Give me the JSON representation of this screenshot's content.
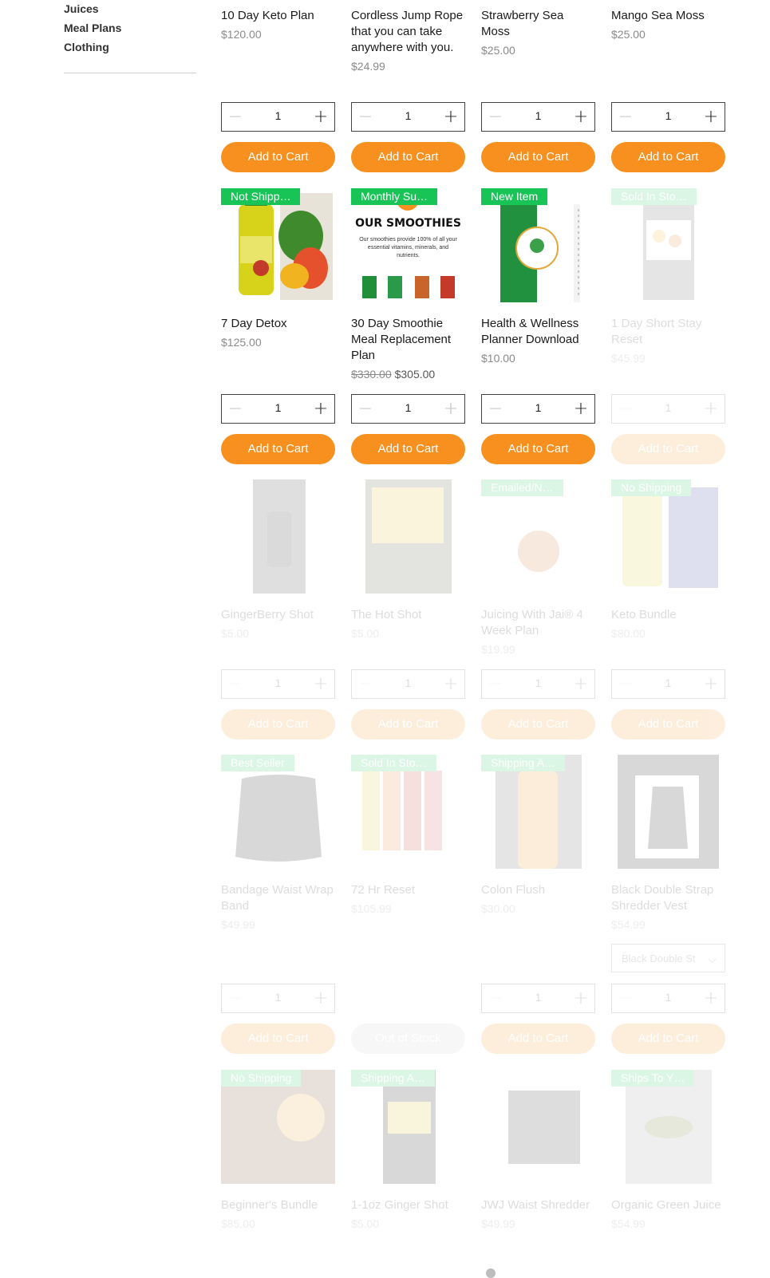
{
  "sidebar": {
    "categories": [
      "Juices",
      "Meal Plans",
      "Clothing"
    ]
  },
  "qty_default": "1",
  "icons": {
    "minus": "minus-icon",
    "plus": "plus-icon",
    "chevron": "chevron-down-icon"
  },
  "colors": {
    "accent": "#f7901e",
    "ribbon": "#17c455"
  },
  "row1": [
    {
      "name": "10 Day Keto Plan",
      "price": "$120.00",
      "button": "Add to Cart"
    },
    {
      "name": "Cordless Jump Rope that you can take anywhere with you.",
      "price": "$24.99",
      "button": "Add to Cart"
    },
    {
      "name": "Strawberry Sea Moss",
      "price": "$25.00",
      "button": "Add to Cart"
    },
    {
      "name": "Mango Sea Moss",
      "price": "$25.00",
      "button": "Add to Cart"
    }
  ],
  "row2": [
    {
      "ribbon": "Not Shipp…",
      "name": "7 Day Detox",
      "price": "$125.00",
      "button": "Add to Cart"
    },
    {
      "ribbon": "Monthly Su…",
      "name": "30 Day Smoothie Meal Replacement Plan",
      "old_price": "$330.00",
      "price": "$305.00",
      "button": "Add to Cart",
      "image_text": "OUR SMOOTHIES",
      "image_subtext": "Our smoothies provide 100% of all your essential vitamins, minerals, and nutrients."
    },
    {
      "ribbon": "New Item",
      "name": "Health & Wellness Planner Download",
      "price": "$10.00",
      "button": "Add to Cart"
    },
    {
      "ribbon": "Sold In Sto…",
      "name": "1 Day Short Stay Reset",
      "price": "$45.99",
      "button": "Add to Cart"
    }
  ],
  "row3": [
    {
      "ribbon": "",
      "name": "GingerBerry Shot",
      "price": "$5.00",
      "button": "Add to Cart"
    },
    {
      "ribbon": "",
      "name": "The Hot Shot",
      "price": "$5.00",
      "button": "Add to Cart"
    },
    {
      "ribbon": "Emailed/N…",
      "name": "Juicing With Jai® 4 Week Plan",
      "price": "$19.99",
      "button": "Add to Cart"
    },
    {
      "ribbon": "No Shipping",
      "name": "Keto Bundle",
      "price": "$80.00",
      "button": "Add to Cart"
    }
  ],
  "row4": [
    {
      "ribbon": "Best Seller",
      "name": "Bandage Waist Wrap Band",
      "price": "$49.99",
      "button": "Add to Cart"
    },
    {
      "ribbon": "Sold In Sto…",
      "name": "72 Hr Reset",
      "price": "$105.99",
      "button": "Out of Stock"
    },
    {
      "ribbon": "Shipping A…",
      "name": "Colon Flush",
      "price": "$30.00",
      "button": "Add to Cart"
    },
    {
      "ribbon": "",
      "name": "Black Double Strap Shredder Vest",
      "price": "$54.99",
      "button": "Add to Cart",
      "select": "Black Double St"
    }
  ],
  "row5": [
    {
      "ribbon": "No Shipping",
      "name": "Beginner's Bundle",
      "price": "$85.00"
    },
    {
      "ribbon": "Shipping A…",
      "name": "1-1oz Ginger Shot",
      "price": "$5.00"
    },
    {
      "ribbon": "",
      "name": "JWJ Waist Shredder",
      "price": "$49.99"
    },
    {
      "ribbon": "Ships To Y…",
      "name": "Organic Green Juice",
      "price": "$54.99"
    }
  ]
}
